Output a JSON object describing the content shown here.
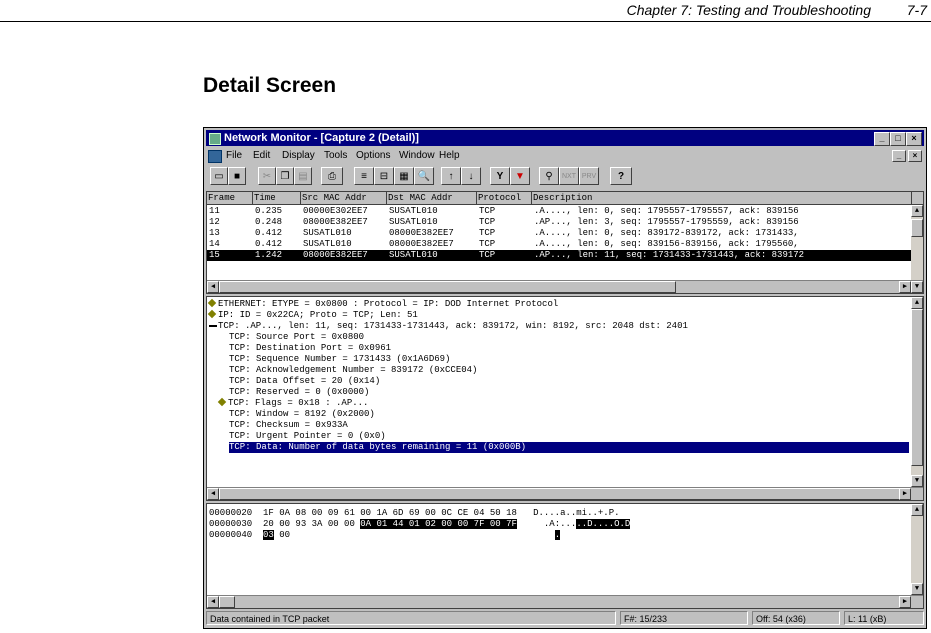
{
  "doc": {
    "chapter": "Chapter 7: Testing and Troubleshooting",
    "page": "7-7",
    "section_title": "Detail Screen"
  },
  "window": {
    "title": "Network Monitor - [Capture 2 (Detail)]",
    "min": "_",
    "max": "□",
    "close": "×"
  },
  "menu": [
    "File",
    "Edit",
    "Display",
    "Tools",
    "Options",
    "Window",
    "Help"
  ],
  "toolbar": {
    "up_arrow": "↑",
    "down_arrow": "↓",
    "filter": "Y",
    "find": "👁",
    "help": "?"
  },
  "summary": {
    "columns": [
      "Frame",
      "Time",
      "Src MAC Addr",
      "Dst MAC Addr",
      "Protocol",
      "Description"
    ],
    "rows": [
      [
        "11",
        "0.235",
        "00000E302EE7",
        "SUSATL010",
        "TCP",
        ".A...., len:    0, seq:   1795557-1795557, ack:    839156"
      ],
      [
        "12",
        "0.248",
        "08000E382EE7",
        "SUSATL010",
        "TCP",
        ".AP..., len:    3, seq:   1795557-1795559, ack:    839156"
      ],
      [
        "13",
        "0.412",
        "SUSATL010",
        "08000E382EE7",
        "TCP",
        ".A...., len:    0, seq:    839172-839172, ack:   1731433,"
      ],
      [
        "14",
        "0.412",
        "SUSATL010",
        "08000E382EE7",
        "TCP",
        ".A...., len:    0, seq:    839156-839156, ack:   1795560,"
      ],
      [
        "15",
        "1.242",
        "08000E382EE7",
        "SUSATL010",
        "TCP",
        ".AP..., len:   11, seq:   1731433-1731443, ack:    839172"
      ]
    ]
  },
  "detail": {
    "lines": [
      "ETHERNET: ETYPE = 0x0800 : Protocol = IP:  DOD Internet Protocol",
      "IP: ID = 0x22CA; Proto = TCP; Len: 51",
      "TCP: .AP..., len:   11, seq:   1731433-1731443, ack:    839172, win: 8192, src: 2048  dst: 2401",
      "TCP: Source Port = 0x0800",
      "TCP: Destination Port = 0x0961",
      "TCP: Sequence Number = 1731433 (0x1A6D69)",
      "TCP: Acknowledgement Number = 839172 (0xCCE04)",
      "TCP: Data Offset = 20 (0x14)",
      "TCP: Reserved = 0 (0x0000)",
      "TCP: Flags = 0x18 : .AP...",
      "TCP: Window = 8192 (0x2000)",
      "TCP: Checksum = 0x933A",
      "TCP: Urgent Pointer = 0 (0x0)",
      "TCP: Data: Number of data bytes remaining = 11 (0x000B)"
    ]
  },
  "hex": {
    "lines": [
      {
        "offset": "00000020",
        "plain": "1F 0A 08 00 09 61 00 1A 6D 69 00 0C CE 04 50 18",
        "hl": "",
        "ascii": "D....a..mi..+.P."
      },
      {
        "offset": "00000030",
        "plain": "20 00 93 3A 00 00",
        "hl": "0A 01 44 01 02 00 00 7F 00 7F",
        "ascii_plain": "  .A:...",
        "ascii_hl": "..D....O.D"
      },
      {
        "offset": "00000040",
        "plain": "00",
        "hl": "03",
        "ascii_hl": "."
      }
    ]
  },
  "status": {
    "message": "Data contained in TCP packet",
    "frame": "F#: 15/233",
    "offset": "Off: 54 (x36)",
    "length": "L: 11 (xB)"
  }
}
